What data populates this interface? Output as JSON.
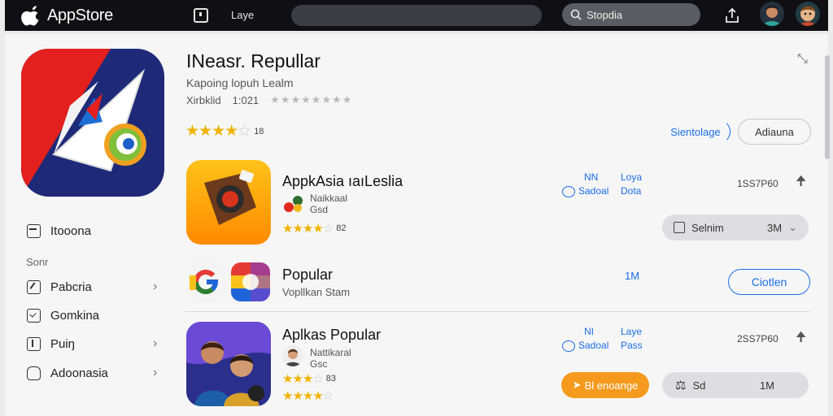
{
  "topbar": {
    "brand": "AppStore",
    "tab_label": "Laye",
    "search_label": "Stopdia"
  },
  "hero": {
    "title": "INeasr. Repullar",
    "subtitle": "Kapoing lopuh Lealm",
    "meta_left": "Xirbklid",
    "meta_date": "1:021",
    "rating_count": "18",
    "link_label": "Sientolage",
    "button_label": "Adiauna"
  },
  "sidebar": {
    "top_item": "Itooona",
    "section": "Sonr",
    "items": [
      {
        "label": "Pabcria"
      },
      {
        "label": "Gomkina"
      },
      {
        "label": "Puiŋ"
      },
      {
        "label": "Adoonasia"
      }
    ]
  },
  "rows": [
    {
      "title": "AppkAsia ıaıLeslia",
      "dev1": "Naikkaal",
      "dev2": "Gsd",
      "rating_count": "82",
      "col1_top": "NN",
      "col1_bottom": "Sadoal",
      "col2_top": "Loya",
      "col2_bottom": "Dota",
      "size": "1SS7P60",
      "button_label": "Selnim",
      "button_value": "3M"
    },
    {
      "title": "Popular",
      "subtitle": "Vopllkan Stam",
      "badge": "1M",
      "button_label": "Ciotlen"
    },
    {
      "title": "Aplkas Popular",
      "dev1": "Nattikaral",
      "dev2": "Gsc",
      "rating_count": "83",
      "col1_top": "NI",
      "col1_bottom": "Sadoal",
      "col2_top": "Laye",
      "col2_bottom": "Pass",
      "size": "2SS7P60",
      "orange_label": "Bl enoange",
      "gray_label": "Sd",
      "gray_value": "1M"
    }
  ],
  "colors": {
    "accent": "#1a6ee6",
    "star": "#f0b300",
    "orange": "#f59a1c",
    "topbar": "#101014"
  }
}
